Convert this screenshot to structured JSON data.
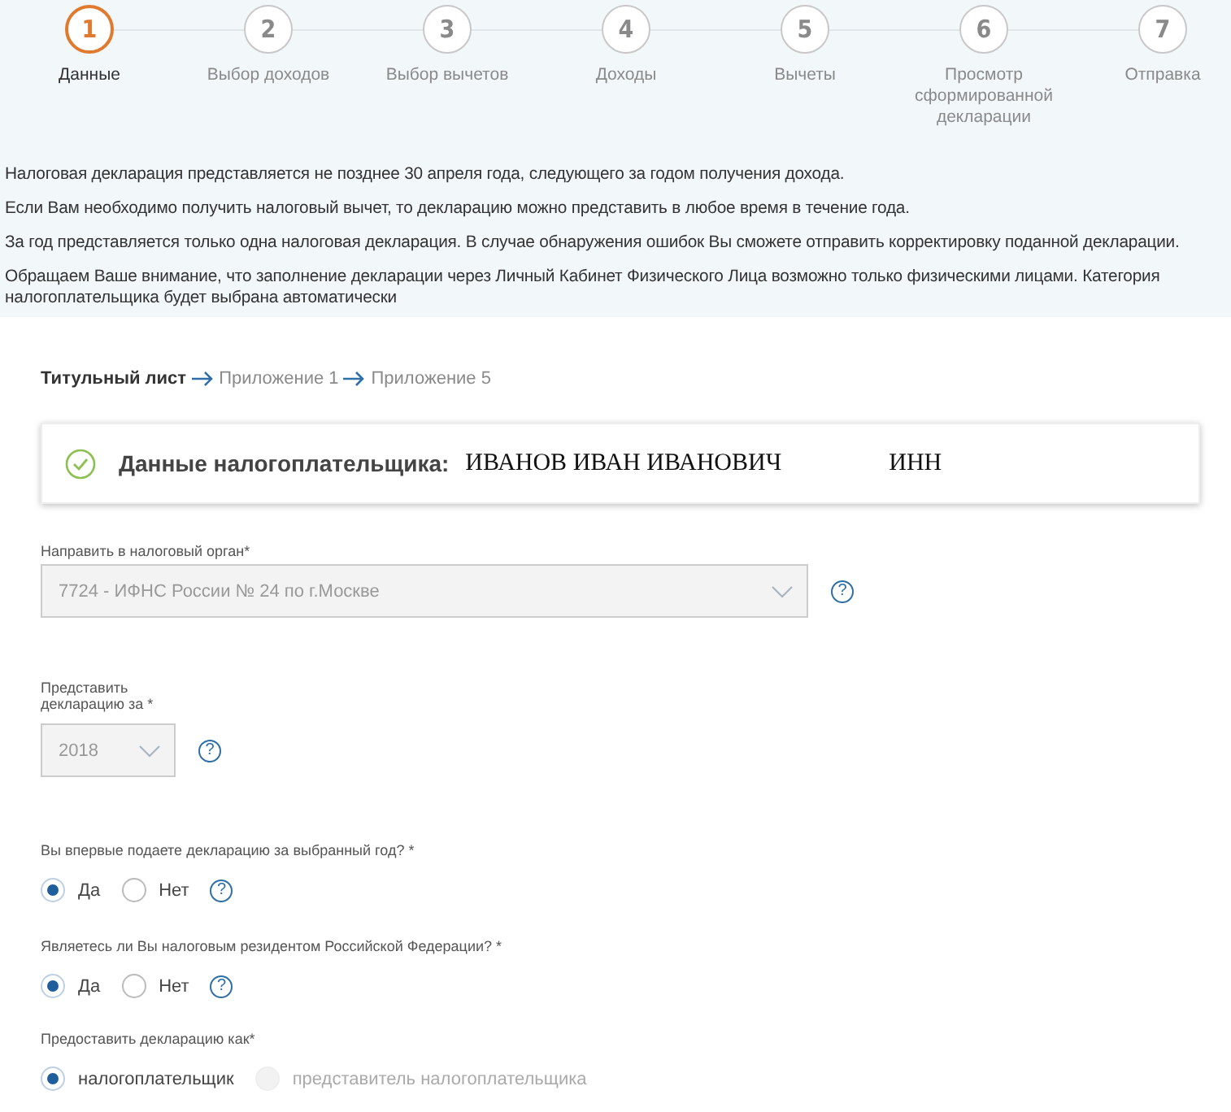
{
  "steps": [
    {
      "number": "1",
      "label": "Данные",
      "selected": true
    },
    {
      "number": "2",
      "label": "Выбор доходов",
      "selected": false
    },
    {
      "number": "3",
      "label": "Выбор вычетов",
      "selected": false
    },
    {
      "number": "4",
      "label": "Доходы",
      "selected": false
    },
    {
      "number": "5",
      "label": "Вычеты",
      "selected": false
    },
    {
      "number": "6",
      "label": "Просмотр сформированной декларации",
      "selected": false
    },
    {
      "number": "7",
      "label": "Отправка",
      "selected": false
    }
  ],
  "notices": [
    "Налоговая декларация представляется не позднее 30 апреля года, следующего за годом получения дохода.",
    "Если Вам необходимо получить налоговый вычет, то декларацию можно представить в любое время в течение года.",
    "За год представляется только одна налоговая декларация. В случае обнаружения ошибок Вы сможете отправить корректировку поданной декларации.",
    "Обращаем Ваше внимание, что заполнение декларации через Личный Кабинет Физического Лица возможно только физическими лицами. Категория налогоплательщика будет выбрана автоматически"
  ],
  "breadcrumb": [
    {
      "label": "Титульный лист",
      "selected": true
    },
    {
      "label": "Приложение 1",
      "selected": false
    },
    {
      "label": "Приложение 5",
      "selected": false
    }
  ],
  "taxpayer": {
    "label": "Данные налогоплательщика:",
    "name": "ИВАНОВ ИВАН ИВАНОВИЧ",
    "inn_label": "ИНН",
    "verified": true
  },
  "fields": [
    {
      "kind": "select",
      "label": "Направить в налоговый орган*",
      "value": "7724 - ИФНС России № 24 по г.Москве",
      "disabled": true,
      "help": "?"
    },
    {
      "kind": "select",
      "label": "Представить декларацию за *",
      "value": "2018",
      "disabled": true,
      "help": "?"
    },
    {
      "kind": "radio",
      "label": "Вы впервые подаете декларацию за выбранный год? *",
      "help": "?",
      "options": [
        {
          "label": "Да",
          "selected": true,
          "disabled": false
        },
        {
          "label": "Нет",
          "selected": false,
          "disabled": false
        }
      ]
    },
    {
      "kind": "radio",
      "label": "Являетесь ли Вы налоговым резидентом Российской Федерации? *",
      "help": "?",
      "options": [
        {
          "label": "Да",
          "selected": true,
          "disabled": false
        },
        {
          "label": "Нет",
          "selected": false,
          "disabled": false
        }
      ]
    },
    {
      "kind": "radio",
      "label": "Предоставить декларацию как*",
      "options": [
        {
          "label": "налогоплательщик",
          "selected": true,
          "disabled": false
        },
        {
          "label": "представитель налогоплательщика",
          "selected": false,
          "disabled": true
        }
      ]
    }
  ]
}
